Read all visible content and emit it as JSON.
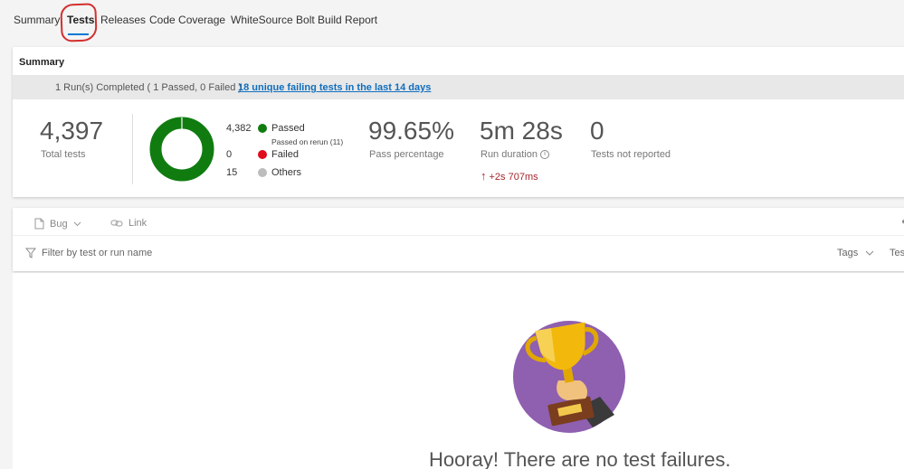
{
  "tabs": [
    {
      "label": "Summary"
    },
    {
      "label": "Tests"
    },
    {
      "label": "Releases"
    },
    {
      "label": "Code Coverage"
    },
    {
      "label": "WhiteSource Bolt Build Report"
    }
  ],
  "summary": {
    "title": "Summary",
    "run_text": "1 Run(s) Completed ( 1 Passed, 0 Failed )",
    "run_link": "18 unique failing tests in the last 14 days",
    "total_tests": {
      "value": "4,397",
      "label": "Total tests"
    },
    "legend": {
      "passed": {
        "count": "4,382",
        "label": "Passed",
        "sub": "Passed on rerun (11)",
        "color": "#107c10"
      },
      "failed": {
        "count": "0",
        "label": "Failed",
        "color": "#e00b1c"
      },
      "others": {
        "count": "15",
        "label": "Others",
        "color": "#bdbdbd"
      }
    },
    "pass_percentage": {
      "value": "99.65%",
      "label": "Pass percentage"
    },
    "run_duration": {
      "value": "5m 28s",
      "label": "Run duration",
      "info_icon": "i",
      "delta": "+2s 707ms"
    },
    "not_reported": {
      "value": "0",
      "label": "Tests not reported"
    }
  },
  "toolbar": {
    "bug_label": "Bug",
    "link_label": "Link",
    "filter_placeholder": "Filter by test or run name",
    "tags_label": "Tags",
    "tes_label": "Tes"
  },
  "empty_state": {
    "message": "Hooray! There are no test failures."
  },
  "colors": {
    "accent": "#0078d4",
    "link": "#106ebe",
    "trophy_bg": "#8f5fb0",
    "delta": "#a4262c"
  }
}
